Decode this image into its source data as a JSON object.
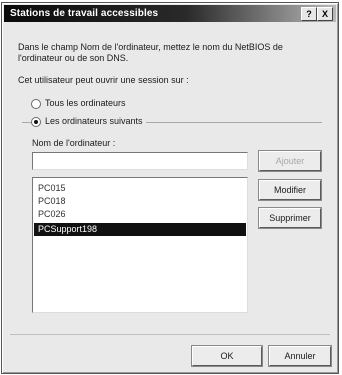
{
  "window": {
    "title": "Stations de travail accessibles",
    "help_label": "?",
    "close_label": "X"
  },
  "description": {
    "line1": "Dans le champ Nom de l'ordinateur, mettez le nom du NetBIOS de",
    "line2": "l'ordinateur ou de son DNS."
  },
  "logon_label": "Cet utilisateur peut ouvrir une session sur :",
  "options": {
    "all_computers": "Tous les ordinateurs",
    "following_computers": "Les ordinateurs suivants",
    "selected": "following_computers"
  },
  "computer_name_label": "Nom de l'ordinateur :",
  "computer_name_value": "",
  "computers": [
    "PC015",
    "PC018",
    "PC026",
    "PCSupport198"
  ],
  "selected_computer": "PCSupport198",
  "buttons": {
    "add": "Ajouter",
    "modify": "Modifier",
    "delete": "Supprimer",
    "ok": "OK",
    "cancel": "Annuler"
  }
}
